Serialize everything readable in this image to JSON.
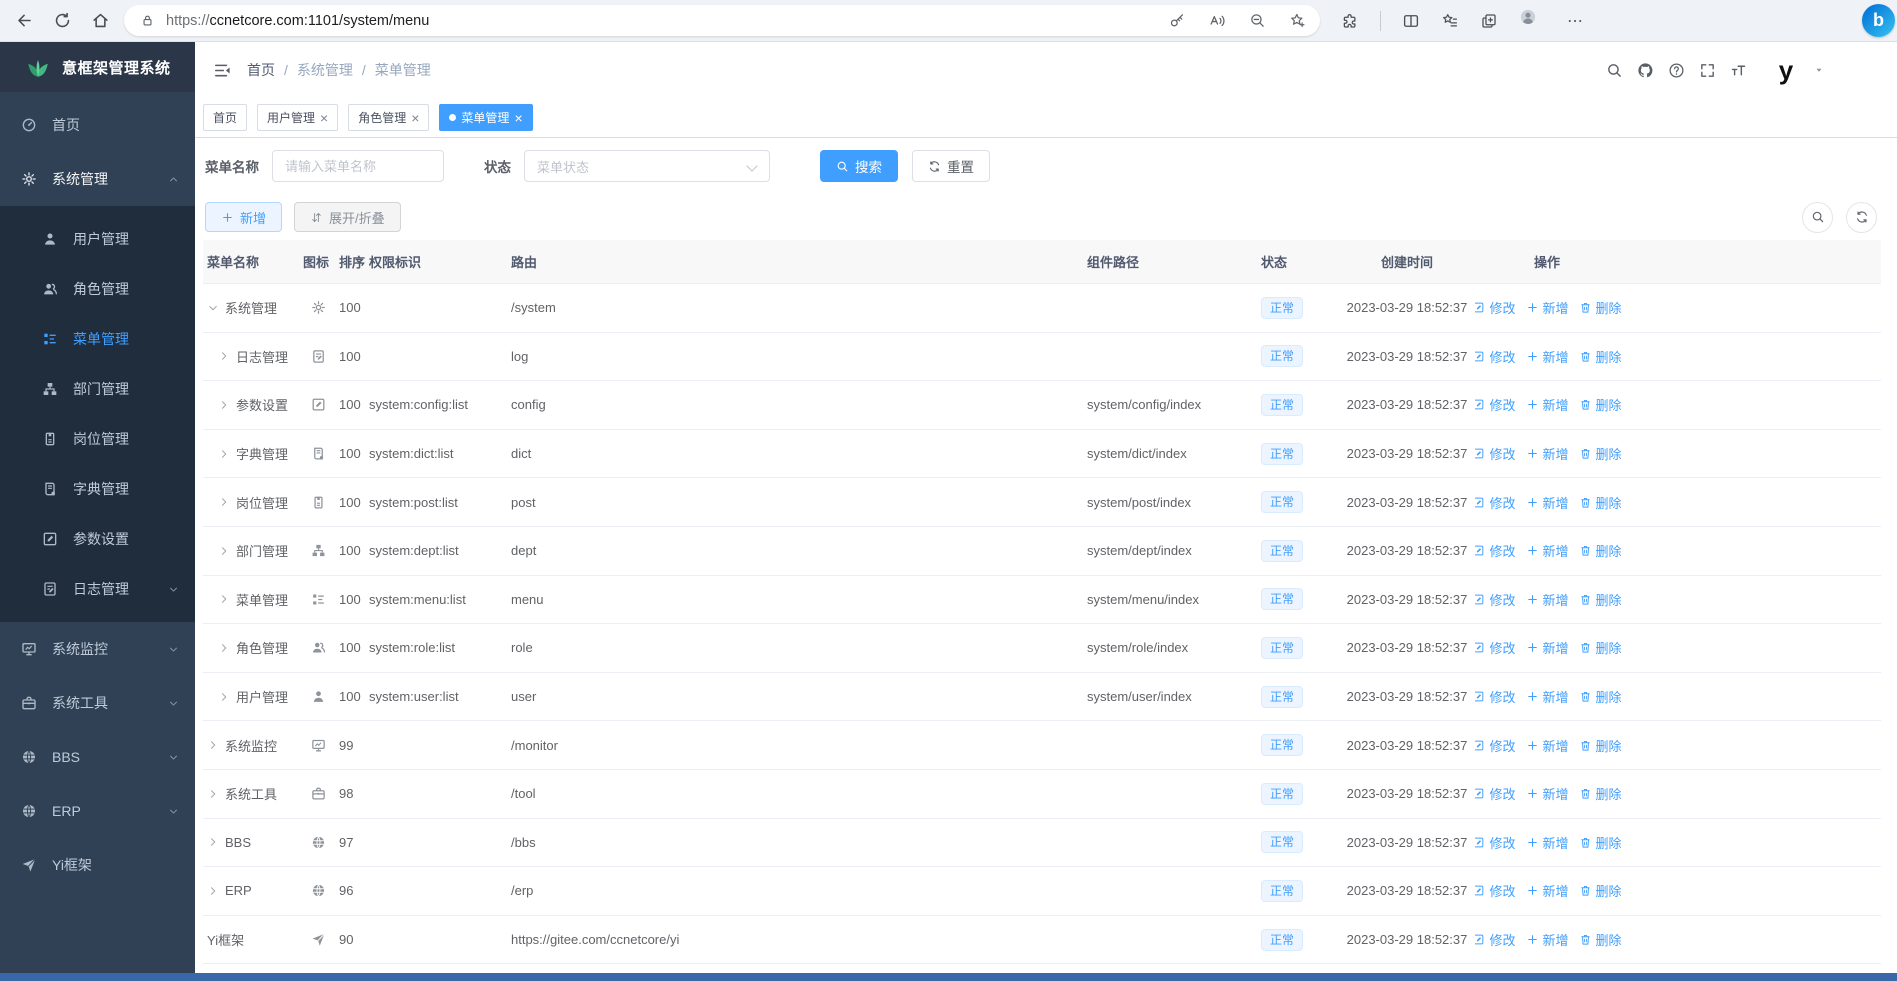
{
  "browser": {
    "url_scheme": "https://",
    "url_host": "ccnetcore.com",
    "url_path": ":1101/system/menu",
    "left_icons": [
      "back",
      "reload",
      "home"
    ],
    "urlbar_icons": [
      "key",
      "read-aloud",
      "zoom-out",
      "star-plus"
    ],
    "right_icons": [
      "extensions",
      "divider",
      "split-screen",
      "collections",
      "copy",
      "profile",
      "more"
    ],
    "bing_label": "b"
  },
  "sidebar": {
    "logo_title": "意框架管理系统",
    "items": [
      {
        "key": "home",
        "label": "首页",
        "icon": "dashboard",
        "type": "top"
      },
      {
        "key": "system",
        "label": "系统管理",
        "icon": "gear",
        "type": "top",
        "open": true,
        "chevron": "up"
      },
      {
        "key": "user",
        "label": "用户管理",
        "icon": "user",
        "type": "sub"
      },
      {
        "key": "role",
        "label": "角色管理",
        "icon": "users",
        "type": "sub"
      },
      {
        "key": "menu",
        "label": "菜单管理",
        "icon": "menu",
        "type": "sub",
        "active": true
      },
      {
        "key": "dept",
        "label": "部门管理",
        "icon": "tree",
        "type": "sub"
      },
      {
        "key": "post",
        "label": "岗位管理",
        "icon": "badge",
        "type": "sub"
      },
      {
        "key": "dict",
        "label": "字典管理",
        "icon": "dict",
        "type": "sub"
      },
      {
        "key": "config",
        "label": "参数设置",
        "icon": "config",
        "type": "sub"
      },
      {
        "key": "log",
        "label": "日志管理",
        "icon": "log",
        "type": "sub",
        "chevron": "down"
      },
      {
        "key": "monitor",
        "label": "系统监控",
        "icon": "monitor",
        "type": "top",
        "chevron": "down"
      },
      {
        "key": "tool",
        "label": "系统工具",
        "icon": "tool",
        "type": "top",
        "chevron": "down"
      },
      {
        "key": "bbs",
        "label": "BBS",
        "icon": "globe",
        "type": "top",
        "chevron": "down"
      },
      {
        "key": "erp",
        "label": "ERP",
        "icon": "globe",
        "type": "top",
        "chevron": "down"
      },
      {
        "key": "yi",
        "label": "Yi框架",
        "icon": "plane",
        "type": "top"
      }
    ]
  },
  "navbar": {
    "breadcrumb": [
      "首页",
      "系统管理",
      "菜单管理"
    ],
    "icons": [
      "search",
      "github",
      "question",
      "fullscreen",
      "font-size"
    ],
    "avatar_text": "y"
  },
  "tabs": [
    {
      "label": "首页",
      "closable": false,
      "active": false
    },
    {
      "label": "用户管理",
      "closable": true,
      "active": false
    },
    {
      "label": "角色管理",
      "closable": true,
      "active": false
    },
    {
      "label": "菜单管理",
      "closable": true,
      "active": true
    }
  ],
  "filters": {
    "name_label": "菜单名称",
    "name_placeholder": "请输入菜单名称",
    "status_label": "状态",
    "status_placeholder": "菜单状态",
    "search_label": "搜索",
    "reset_label": "重置"
  },
  "toolbar": {
    "add_label": "新增",
    "expand_label": "展开/折叠",
    "right_icons": [
      "search",
      "refresh"
    ]
  },
  "table": {
    "columns": [
      "菜单名称",
      "图标",
      "排序",
      "权限标识",
      "路由",
      "组件路径",
      "状态",
      "创建时间",
      "操作"
    ],
    "actions": {
      "edit": "修改",
      "add": "新增",
      "delete": "删除"
    },
    "rows": [
      {
        "name": "系统管理",
        "arrow": "down",
        "level": 0,
        "icon": "gear",
        "sort": "100",
        "perm": "",
        "route": "/system",
        "comp": "",
        "status": "正常",
        "created": "2023-03-29 18:52:37"
      },
      {
        "name": "日志管理",
        "arrow": "right",
        "level": 1,
        "icon": "log",
        "sort": "100",
        "perm": "",
        "route": "log",
        "comp": "",
        "status": "正常",
        "created": "2023-03-29 18:52:37"
      },
      {
        "name": "参数设置",
        "arrow": "right",
        "level": 1,
        "icon": "config",
        "sort": "100",
        "perm": "system:config:list",
        "route": "config",
        "comp": "system/config/index",
        "status": "正常",
        "created": "2023-03-29 18:52:37"
      },
      {
        "name": "字典管理",
        "arrow": "right",
        "level": 1,
        "icon": "dict",
        "sort": "100",
        "perm": "system:dict:list",
        "route": "dict",
        "comp": "system/dict/index",
        "status": "正常",
        "created": "2023-03-29 18:52:37"
      },
      {
        "name": "岗位管理",
        "arrow": "right",
        "level": 1,
        "icon": "badge",
        "sort": "100",
        "perm": "system:post:list",
        "route": "post",
        "comp": "system/post/index",
        "status": "正常",
        "created": "2023-03-29 18:52:37"
      },
      {
        "name": "部门管理",
        "arrow": "right",
        "level": 1,
        "icon": "tree",
        "sort": "100",
        "perm": "system:dept:list",
        "route": "dept",
        "comp": "system/dept/index",
        "status": "正常",
        "created": "2023-03-29 18:52:37"
      },
      {
        "name": "菜单管理",
        "arrow": "right",
        "level": 1,
        "icon": "menu",
        "sort": "100",
        "perm": "system:menu:list",
        "route": "menu",
        "comp": "system/menu/index",
        "status": "正常",
        "created": "2023-03-29 18:52:37"
      },
      {
        "name": "角色管理",
        "arrow": "right",
        "level": 1,
        "icon": "users",
        "sort": "100",
        "perm": "system:role:list",
        "route": "role",
        "comp": "system/role/index",
        "status": "正常",
        "created": "2023-03-29 18:52:37"
      },
      {
        "name": "用户管理",
        "arrow": "right",
        "level": 1,
        "icon": "user",
        "sort": "100",
        "perm": "system:user:list",
        "route": "user",
        "comp": "system/user/index",
        "status": "正常",
        "created": "2023-03-29 18:52:37"
      },
      {
        "name": "系统监控",
        "arrow": "right",
        "level": 0,
        "icon": "monitor",
        "sort": "99",
        "perm": "",
        "route": "/monitor",
        "comp": "",
        "status": "正常",
        "created": "2023-03-29 18:52:37"
      },
      {
        "name": "系统工具",
        "arrow": "right",
        "level": 0,
        "icon": "tool",
        "sort": "98",
        "perm": "",
        "route": "/tool",
        "comp": "",
        "status": "正常",
        "created": "2023-03-29 18:52:37"
      },
      {
        "name": "BBS",
        "arrow": "right",
        "level": 0,
        "icon": "globe",
        "sort": "97",
        "perm": "",
        "route": "/bbs",
        "comp": "",
        "status": "正常",
        "created": "2023-03-29 18:52:37"
      },
      {
        "name": "ERP",
        "arrow": "right",
        "level": 0,
        "icon": "globe",
        "sort": "96",
        "perm": "",
        "route": "/erp",
        "comp": "",
        "status": "正常",
        "created": "2023-03-29 18:52:37"
      },
      {
        "name": "Yi框架",
        "arrow": "",
        "level": 0,
        "icon": "plane",
        "sort": "90",
        "perm": "",
        "route": "https://gitee.com/ccnetcore/yi",
        "comp": "",
        "status": "正常",
        "created": "2023-03-29 18:52:37"
      }
    ]
  },
  "colors": {
    "accent": "#409eff",
    "sidebar_bg": "#304156",
    "submenu_bg": "#1f2d3d",
    "sidebar_text": "#bfcbd9",
    "tag_bg": "#ecf5ff",
    "tag_border": "#d9ecff",
    "table_header_bg": "#f8f8f9",
    "row_border": "#ebeef5",
    "bottom_bar": "#3a67a8",
    "logo_green": "#43b884"
  }
}
